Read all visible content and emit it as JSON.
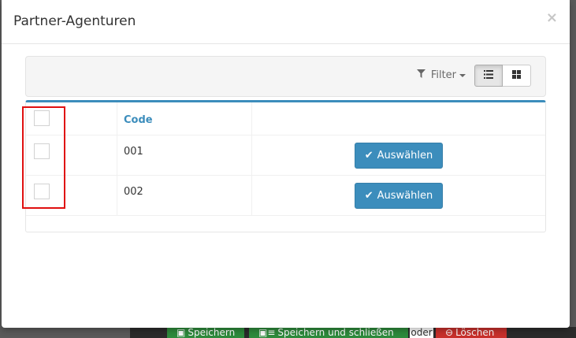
{
  "modal": {
    "title": "Partner-Agenturen",
    "close_symbol": "×"
  },
  "toolbar": {
    "filter_label": "Filter",
    "view_list_icon": "list-icon",
    "view_grid_icon": "grid-icon"
  },
  "table": {
    "columns": [
      "",
      "Code",
      ""
    ],
    "rows": [
      {
        "code": "001",
        "action_label": "Auswählen"
      },
      {
        "code": "002",
        "action_label": "Auswählen"
      }
    ]
  },
  "backdrop": {
    "save_label": "Speichern",
    "save_close_label": "Speichern und schließen",
    "or_label": "oder",
    "delete_label": "Löschen"
  },
  "colors": {
    "primary": "#3c8dbc",
    "highlight": "#e01010",
    "save_green": "#2e8b3c",
    "delete_red": "#c9302c"
  }
}
